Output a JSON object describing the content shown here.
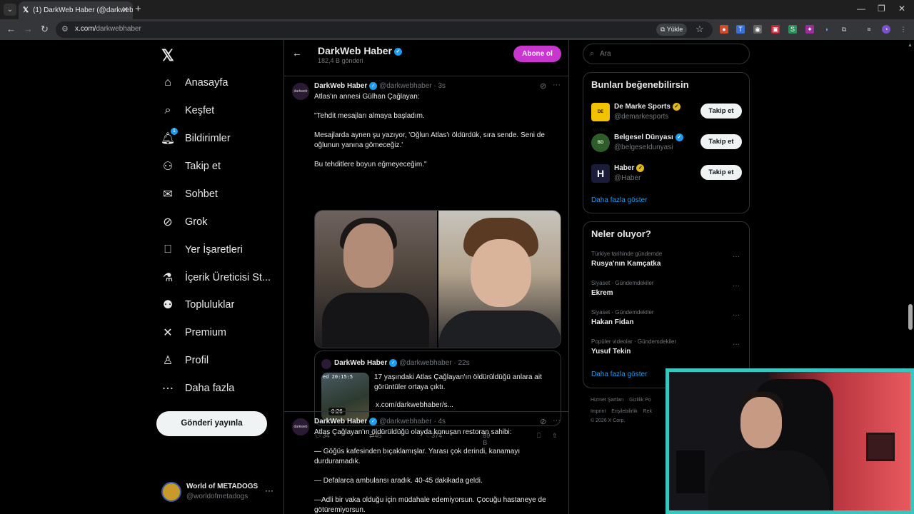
{
  "browser": {
    "tab_title": "(1) DarkWeb Haber (@darkwebh",
    "url_host": "x.com/",
    "url_path": "darkwebhaber",
    "install_label": "Yükle",
    "new_tab_icon": "plus-icon",
    "window_controls": [
      "—",
      "❐",
      "✕"
    ]
  },
  "nav": {
    "items": [
      {
        "label": "Anasayfa",
        "icon": "home-icon",
        "glyph": "⌂"
      },
      {
        "label": "Keşfet",
        "icon": "search-icon",
        "glyph": "⌕"
      },
      {
        "label": "Bildirimler",
        "icon": "bell-icon",
        "glyph": "♫",
        "badge": "1"
      },
      {
        "label": "Takip et",
        "icon": "person-plus-icon",
        "glyph": "⚇"
      },
      {
        "label": "Sohbet",
        "icon": "mail-icon",
        "glyph": "✉"
      },
      {
        "label": "Grok",
        "icon": "grok-icon",
        "glyph": "⊘"
      },
      {
        "label": "Yer İşaretleri",
        "icon": "bookmark-icon",
        "glyph": "⎕"
      },
      {
        "label": "İçerik Üreticisi St...",
        "icon": "flask-icon",
        "glyph": "⚗"
      },
      {
        "label": "Topluluklar",
        "icon": "people-icon",
        "glyph": "⚉"
      },
      {
        "label": "Premium",
        "icon": "x-logo-icon",
        "glyph": "✕"
      },
      {
        "label": "Profil",
        "icon": "user-icon",
        "glyph": "♙"
      },
      {
        "label": "Daha fazla",
        "icon": "more-circle-icon",
        "glyph": "⋯"
      }
    ],
    "post_button": "Gönderi yayınla",
    "account_name": "World of METADOGS",
    "account_handle": "@worldofmetadogs"
  },
  "profile_header": {
    "name": "DarkWeb Haber",
    "post_count": "182,4 B gönderi",
    "subscribe": "Abone ol"
  },
  "tweet1": {
    "name": "DarkWeb Haber",
    "handle": "@darkwebhaber",
    "time": "· 3s",
    "lines": [
      "Atlas'ın annesi Gülhan Çağlayan:",
      "\"Tehdit mesajları almaya başladım.",
      "Mesajlarda aynen şu yazıyor, 'Oğlun Atlas'ı öldürdük, sıra sende. Seni de oğlunun yanına gömeceğiz.'",
      "Bu tehditlere boyun eğmeyeceğim.\""
    ],
    "quote": {
      "name": "DarkWeb Haber",
      "handle": "@darkwebhaber",
      "time": "· 22s",
      "text": "17 yaşındaki Atlas Çağlayan'ın öldürüldüğü anlara ait görüntüler ortaya çıktı.",
      "link": "x.com/darkwebhaber/s...",
      "duration": "0:26",
      "timestamp_overlay": "ed 20:15:5"
    },
    "stats": {
      "replies": "34",
      "reposts": "45",
      "likes": "374",
      "views": "89 B"
    }
  },
  "tweet2": {
    "name": "DarkWeb Haber",
    "handle": "@darkwebhaber",
    "time": "· 4s",
    "lines": [
      "Atlas Çağlayan'ın öldürüldüğü olayda konuşan restoran sahibi:",
      "— Göğüs kafesinden bıçaklamışlar. Yarası çok derindi, kanamayı durduramadık.",
      "— Defalarca ambulansı aradık. 40-45 dakikada geldi.",
      "—Adli bir vaka olduğu için müdahale edemiyorsun. Çocuğu hastaneye de götüremiyorsun."
    ]
  },
  "sidebar": {
    "search_placeholder": "Ara",
    "suggestions_title": "Bunları beğenebilirsin",
    "suggestions": [
      {
        "name": "De Marke Sports",
        "handle": "@demarkesports",
        "verified": "gold",
        "avatar_text": "DE MARKE",
        "avatar_bg": "#f2c200",
        "avatar_fg": "#111111"
      },
      {
        "name": "Belgesel Dünyası",
        "handle": "@belgeseIdunyasi",
        "verified": "blue",
        "avatar_text": "BD",
        "avatar_bg": "#2e5d2b",
        "avatar_fg": "#d8e8c8"
      },
      {
        "name": "Haber",
        "handle": "@Haber",
        "verified": "gold",
        "avatar_text": "H",
        "avatar_bg": "#1a1c3a",
        "avatar_fg": "#ffffff"
      }
    ],
    "follow_label": "Takip et",
    "show_more": "Daha fazla göster",
    "trends_title": "Neler oluyor?",
    "trends": [
      {
        "category": "Türkiye tarihinde gündemde",
        "name": "Rusya'nın Kamçatka"
      },
      {
        "category": "Siyaset · Gündemdekiler",
        "name": "Ekrem"
      },
      {
        "category": "Siyaset · Gündemdekiler",
        "name": "Hakan Fidan"
      },
      {
        "category": "Popüler videolar · Gündemdekiler",
        "name": "Yusuf Tekin"
      }
    ],
    "trends_show_more": "Daha fazla göster",
    "footer": [
      "Hizmet Şartları",
      "Gizlilik Po",
      "Imprint",
      "Erişilebilirlik",
      "Rek",
      "© 2026 X Corp."
    ]
  },
  "colors": {
    "accent": "#1d9bf0",
    "subscribe": "#c936cf",
    "webcam_border": "#37c7c0"
  }
}
